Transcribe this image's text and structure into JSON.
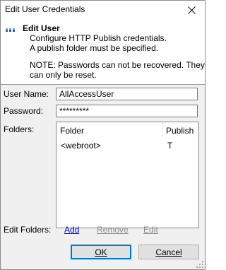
{
  "window": {
    "title": "Edit User Credentials"
  },
  "header": {
    "title": "Edit User",
    "line1": "Configure HTTP Publish credentials.",
    "line2": "A publish folder must be specified.",
    "note1": "NOTE: Passwords can not be recovered. They",
    "note2": "can only be reset."
  },
  "form": {
    "username_label": "User Name:",
    "username_value": "AllAccessUser",
    "password_label": "Password:",
    "password_value": "*********",
    "folders_label": "Folders:"
  },
  "folders": {
    "columns": {
      "folder": "Folder",
      "publish": "Publish"
    },
    "rows": [
      {
        "folder": "<webroot>",
        "publish": "T"
      }
    ]
  },
  "edit_folders": {
    "label": "Edit Folders:",
    "add": "Add",
    "remove": "Remove",
    "edit": "Edit"
  },
  "buttons": {
    "ok": "OK",
    "cancel": "Cancel"
  },
  "colors": {
    "accent": "#0078d7",
    "link": "#0000ff",
    "disabled": "#8a8a8a"
  }
}
